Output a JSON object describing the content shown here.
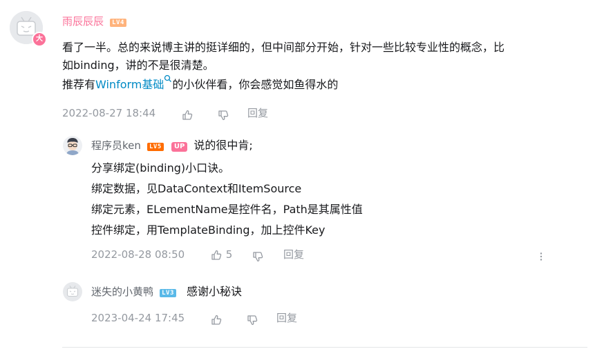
{
  "comment": {
    "username": "雨辰辰辰",
    "level": "LV4",
    "avatar_badge": "大",
    "text_line1": "看了一半。总的来说博主讲的挺详细的，但中间部分开始，针对一些比较专业性的概念，比",
    "text_line2": "如binding，讲的不是很清楚。",
    "text_line3_prefix": "推荐有",
    "text_line3_link": "Winform基础",
    "text_line3_suffix": "的小伙伴看，你会感觉如鱼得水的",
    "time": "2022-08-27 18:44",
    "reply_label": "回复"
  },
  "replies": [
    {
      "username": "程序员ken",
      "level": "LV5",
      "up_badge": "UP",
      "lines": [
        "说的很中肯;",
        "分享绑定(binding)小口诀。",
        "绑定数据，见DataContext和ItemSource",
        "绑定元素，ELementName是控件名，Path是其属性值",
        "控件绑定，用TemplateBinding，加上控件Key"
      ],
      "time": "2022-08-28 08:50",
      "like_count": "5",
      "reply_label": "回复"
    },
    {
      "username": "迷失的小黄鸭",
      "level": "LV3",
      "text": "感谢小秘诀",
      "time": "2023-04-24 17:45",
      "reply_label": "回复"
    }
  ],
  "icons": {
    "like": "thumbs-up-icon",
    "dislike": "thumbs-down-icon",
    "search": "search-icon",
    "more": "more-vertical-icon"
  },
  "colors": {
    "pink": "#fb7299",
    "link": "#008ac5",
    "meta_gray": "#9499a0",
    "lv3": "#5ab9e8",
    "lv4": "#ffb37c",
    "lv5": "#ff6c00"
  }
}
